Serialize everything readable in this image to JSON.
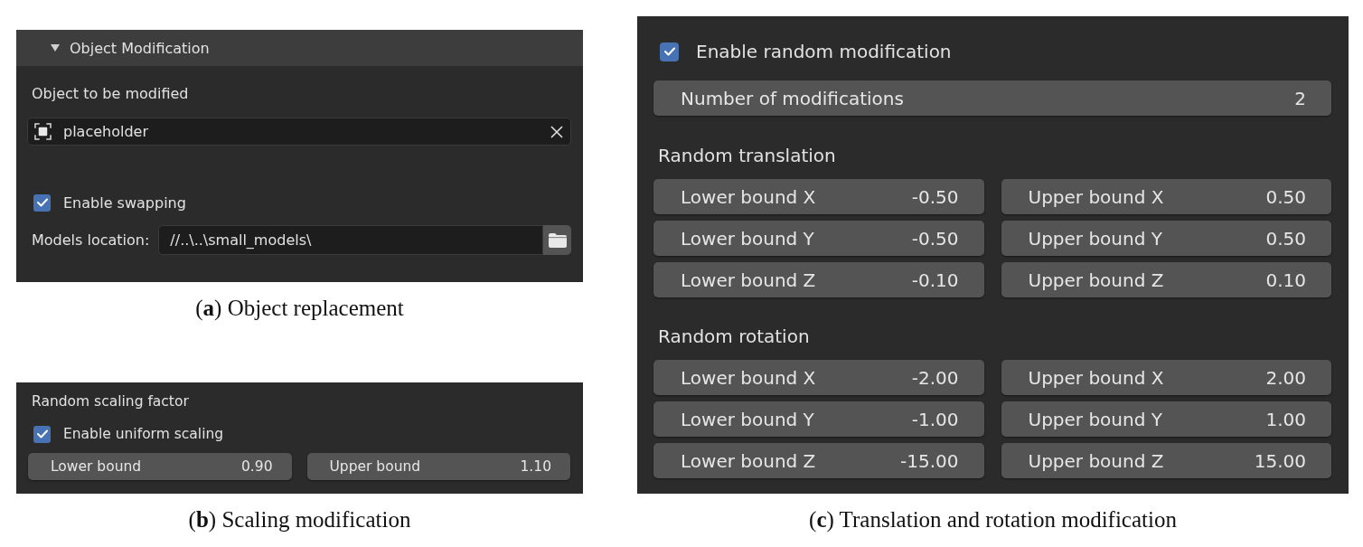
{
  "object_modification_panel": {
    "title": "Object Modification",
    "expanded": true,
    "object_label": "Object to be modified",
    "object_field": {
      "value": "placeholder"
    },
    "swap_checkbox": {
      "label": "Enable swapping",
      "checked": true
    },
    "models_location": {
      "label": "Models location:",
      "value": "//..\\..\\small_models\\"
    },
    "caption": "(**a**) Object replacement"
  },
  "scaling_panel": {
    "title": "Random scaling factor",
    "uniform_checkbox": {
      "label": "Enable uniform scaling",
      "checked": true
    },
    "fields": [
      {
        "label": "Lower bound",
        "value": "0.90"
      },
      {
        "label": "Upper bound",
        "value": "1.10"
      }
    ],
    "caption": "(**b**) Scaling modification"
  },
  "random_modification_panel": {
    "enable_checkbox": {
      "label": "Enable random modification",
      "checked": true
    },
    "count_field": {
      "label": "Number of modifications",
      "value": "2"
    },
    "sections": [
      {
        "title": "Random translation",
        "fields": [
          {
            "label": "Lower bound X",
            "value": "-0.50"
          },
          {
            "label": "Upper bound X",
            "value": "0.50"
          },
          {
            "label": "Lower bound Y",
            "value": "-0.50"
          },
          {
            "label": "Upper bound Y",
            "value": "0.50"
          },
          {
            "label": "Lower bound Z",
            "value": "-0.10"
          },
          {
            "label": "Upper bound Z",
            "value": "0.10"
          }
        ]
      },
      {
        "title": "Random rotation",
        "fields": [
          {
            "label": "Lower bound X",
            "value": "-2.00"
          },
          {
            "label": "Upper bound X",
            "value": "2.00"
          },
          {
            "label": "Lower bound Y",
            "value": "-1.00"
          },
          {
            "label": "Upper bound Y",
            "value": "1.00"
          },
          {
            "label": "Lower bound Z",
            "value": "-15.00"
          },
          {
            "label": "Upper bound Z",
            "value": "15.00"
          }
        ]
      }
    ],
    "caption": "(**c**) Translation and rotation modification"
  }
}
